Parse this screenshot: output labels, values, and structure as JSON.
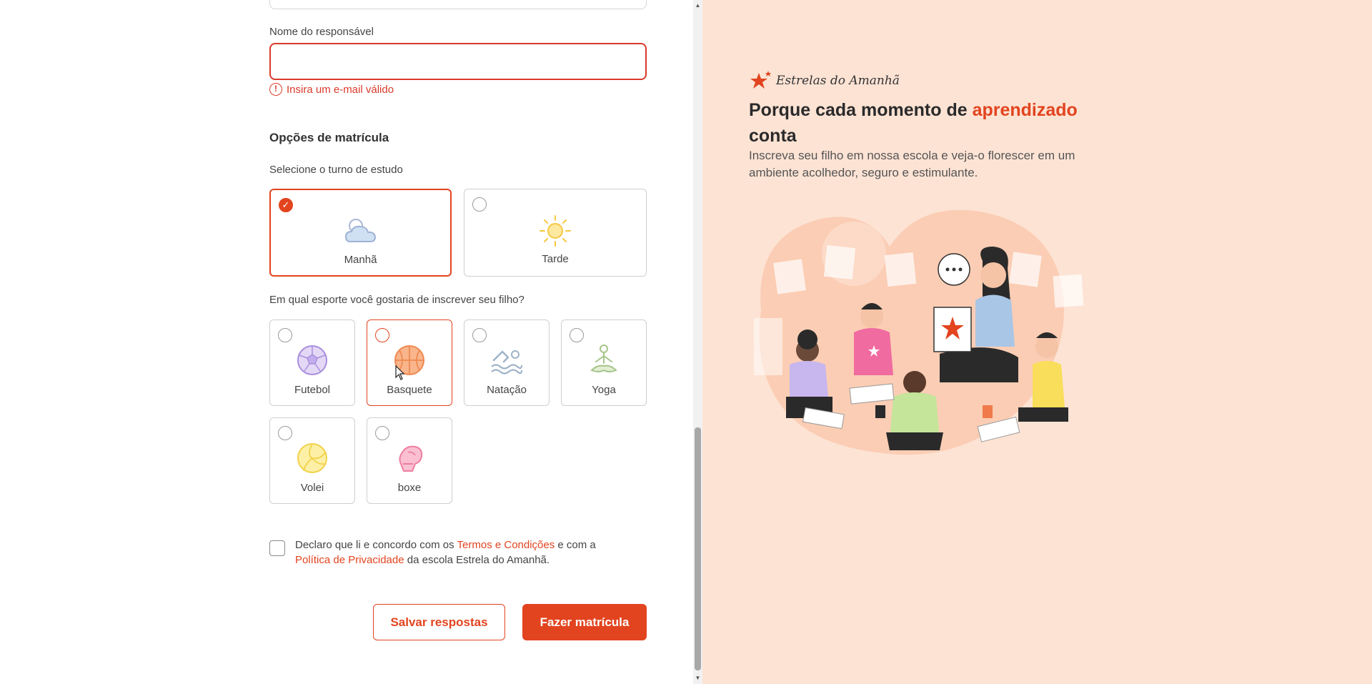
{
  "form": {
    "guardian_name_label": "Nome do responsável",
    "guardian_name_value": "",
    "error_message": "Insira um e-mail válido",
    "error_icon": "!",
    "section_title": "Opções de matrícula",
    "shift_label": "Selecione o turno de estudo",
    "shifts": [
      {
        "label": "Manhã",
        "icon": "cloud-sun-icon",
        "selected": true
      },
      {
        "label": "Tarde",
        "icon": "sun-icon",
        "selected": false
      }
    ],
    "sport_label": "Em qual esporte você gostaria de inscrever seu filho?",
    "sports": [
      {
        "label": "Futebol",
        "icon": "soccer-ball-icon"
      },
      {
        "label": "Basquete",
        "icon": "basketball-icon"
      },
      {
        "label": "Natação",
        "icon": "swimmer-icon"
      },
      {
        "label": "Yoga",
        "icon": "yoga-icon"
      },
      {
        "label": "Volei",
        "icon": "volleyball-icon"
      },
      {
        "label": "boxe",
        "icon": "boxing-glove-icon"
      }
    ],
    "terms": {
      "part1": "Declaro que li e concordo com os ",
      "terms_link": "Termos e Condições",
      "part2": " e com a ",
      "privacy_link": "Política de Privacidade",
      "part3": " da escola Estrela do Amanhã."
    },
    "save_button": "Salvar respostas",
    "submit_button": "Fazer matrícula"
  },
  "promo": {
    "brand_name": "Estrelas do Amanhã",
    "headline_part1": "Porque cada momento de ",
    "headline_accent": "aprendizado",
    "headline_part2": " conta",
    "subhead": "Inscreva seu filho em nossa escola e veja-o florescer em um ambiente acolhedor, seguro e estimulante."
  },
  "colors": {
    "accent": "#e2441f",
    "error": "#d93a2a",
    "promo_bg": "#fde3d4"
  }
}
